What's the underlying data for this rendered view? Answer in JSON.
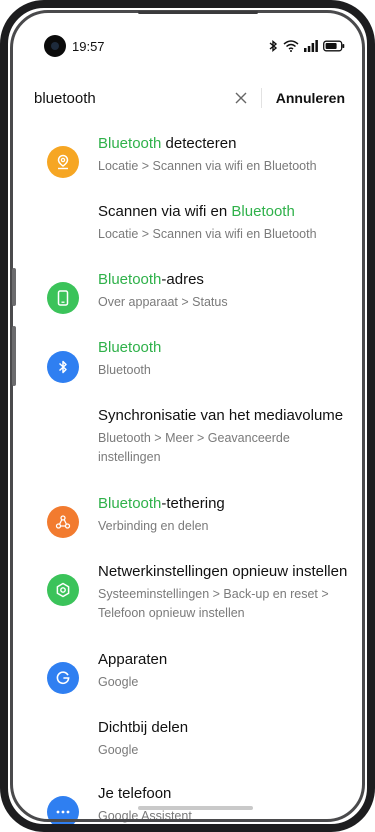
{
  "status_bar": {
    "time": "19:57"
  },
  "search": {
    "query": "bluetooth",
    "cancel_label": "Annuleren"
  },
  "colors": {
    "highlight": "#2fb14a",
    "orange": "#f6a623",
    "green": "#3bc35a",
    "blue": "#2f7ff1",
    "deep_orange": "#f27b2f"
  },
  "results": [
    {
      "title_hl": "Bluetooth",
      "title_rest": " detecteren",
      "subtitle": "Locatie > Scannen via wifi en Bluetooth",
      "icon": "location-pin-icon"
    },
    {
      "title_pre": "Scannen via wifi en ",
      "title_hl": "Bluetooth",
      "subtitle": "Locatie > Scannen via wifi en Bluetooth"
    },
    {
      "title_hl": "Bluetooth",
      "title_rest": "-adres",
      "subtitle": "Over apparaat > Status",
      "icon": "phone-icon"
    },
    {
      "title_hl": "Bluetooth",
      "subtitle": "Bluetooth",
      "icon": "bluetooth-icon"
    },
    {
      "title": "Synchronisatie van het mediavolume",
      "subtitle": "Bluetooth > Meer > Geavanceerde instellingen"
    },
    {
      "title_hl": "Bluetooth",
      "title_rest": "-tethering",
      "subtitle": "Verbinding en delen",
      "icon": "tethering-icon"
    },
    {
      "title": "Netwerkinstellingen opnieuw instellen",
      "subtitle": "Systeeminstellingen > Back-up en reset > Telefoon opnieuw instellen",
      "icon": "settings-gear-icon"
    },
    {
      "title": "Apparaten",
      "subtitle": "Google",
      "icon": "google-icon"
    },
    {
      "title": "Dichtbij delen",
      "subtitle": "Google"
    },
    {
      "title": "Je telefoon",
      "subtitle": "Google Assistent",
      "icon": "more-dots-icon"
    }
  ]
}
